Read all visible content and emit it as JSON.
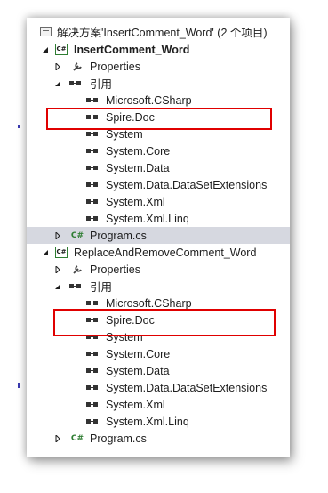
{
  "solution": {
    "label": "解决方案'InsertComment_Word' (2 个项目)",
    "icon": "solution-icon"
  },
  "project1": {
    "label": "InsertComment_Word",
    "properties": "Properties",
    "references": "引用",
    "refs": [
      "Microsoft.CSharp",
      "Spire.Doc",
      "System",
      "System.Core",
      "System.Data",
      "System.Data.DataSetExtensions",
      "System.Xml",
      "System.Xml.Linq"
    ],
    "program": "Program.cs"
  },
  "project2": {
    "label": "ReplaceAndRemoveComment_Word",
    "properties": "Properties",
    "references": "引用",
    "refs": [
      "Microsoft.CSharp",
      "Spire.Doc",
      "System",
      "System.Core",
      "System.Data",
      "System.Data.DataSetExtensions",
      "System.Xml",
      "System.Xml.Linq"
    ],
    "program": "Program.cs"
  },
  "icons": {
    "csproj": "C#",
    "csfile": "C#"
  },
  "colors": {
    "selection": "#d6d8e0",
    "highlight": "#e00000",
    "cs_green": "#2e7d32"
  }
}
